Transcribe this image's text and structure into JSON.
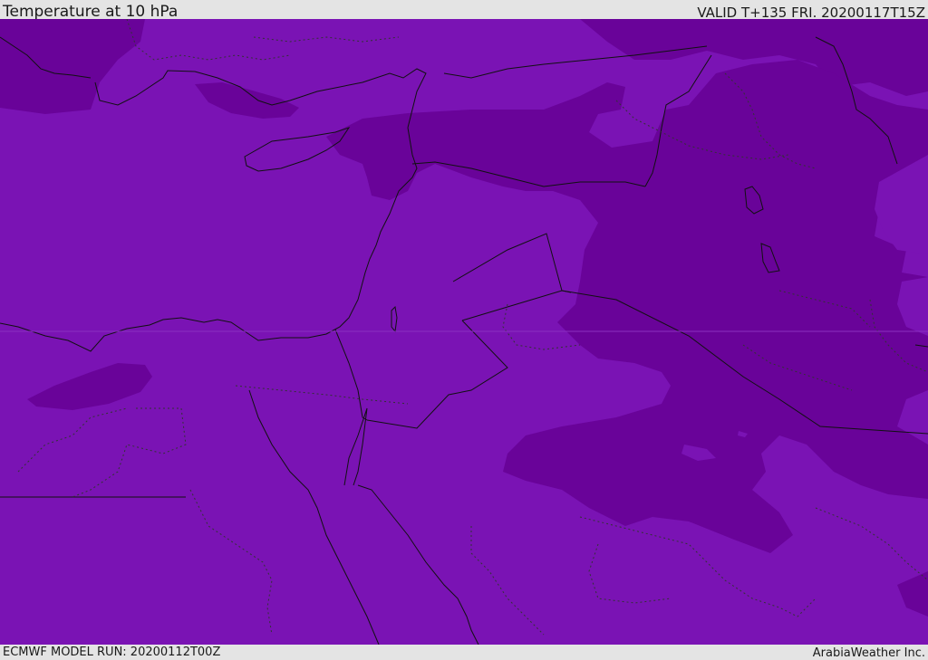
{
  "header": {
    "title": "Temperature at 10 hPa",
    "valid_time": "VALID T+135 FRI. 20200117T15Z"
  },
  "footer": {
    "model_run": "ECMWF MODEL RUN: 20200112T00Z",
    "credit": "ArabiaWeather Inc."
  },
  "map": {
    "colors": {
      "fill_main": "#7a13b4",
      "fill_dark": "#690399",
      "coastline": "#111111",
      "borders": "#333333"
    }
  }
}
